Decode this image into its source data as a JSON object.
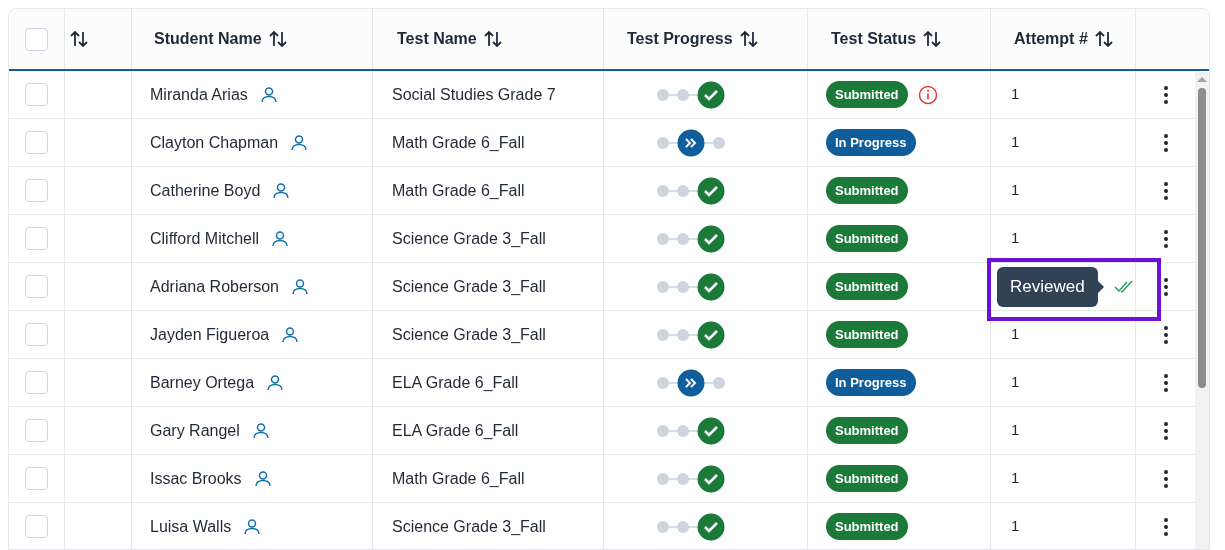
{
  "header": {
    "select_all": {
      "checked": false
    },
    "columns": [
      "Student Name",
      "Test Name",
      "Test Progress",
      "Test Status",
      "Attempt #"
    ]
  },
  "rows": [
    {
      "checked": false,
      "student": "Miranda Arias",
      "test": "Social Studies Grade 7",
      "progress": {
        "kind": "submitted"
      },
      "status": {
        "label": "Submitted",
        "kind": "submitted"
      },
      "alert": true,
      "attempt": "1"
    },
    {
      "checked": false,
      "student": "Clayton Chapman",
      "test": "Math Grade 6_Fall",
      "progress": {
        "kind": "in_progress"
      },
      "status": {
        "label": "In Progress",
        "kind": "in_progress"
      },
      "alert": false,
      "attempt": "1"
    },
    {
      "checked": false,
      "student": "Catherine Boyd",
      "test": "Math Grade 6_Fall",
      "progress": {
        "kind": "submitted"
      },
      "status": {
        "label": "Submitted",
        "kind": "submitted"
      },
      "alert": false,
      "attempt": "1"
    },
    {
      "checked": false,
      "student": "Clifford Mitchell",
      "test": "Science Grade 3_Fall",
      "progress": {
        "kind": "submitted"
      },
      "status": {
        "label": "Submitted",
        "kind": "submitted"
      },
      "alert": false,
      "attempt": "1"
    },
    {
      "checked": false,
      "student": "Adriana Roberson",
      "test": "Science Grade 3_Fall",
      "progress": {
        "kind": "submitted"
      },
      "status": {
        "label": "Submitted",
        "kind": "submitted"
      },
      "alert": false,
      "reviewed": true,
      "tooltip": "Reviewed",
      "highlighted": true
    },
    {
      "checked": false,
      "student": "Jayden Figueroa",
      "test": "Science Grade 3_Fall",
      "progress": {
        "kind": "submitted"
      },
      "status": {
        "label": "Submitted",
        "kind": "submitted"
      },
      "alert": false,
      "attempt": "1"
    },
    {
      "checked": false,
      "student": "Barney Ortega",
      "test": "ELA Grade 6_Fall",
      "progress": {
        "kind": "in_progress"
      },
      "status": {
        "label": "In Progress",
        "kind": "in_progress"
      },
      "alert": false,
      "attempt": "1"
    },
    {
      "checked": false,
      "student": "Gary Rangel",
      "test": "ELA Grade 6_Fall",
      "progress": {
        "kind": "submitted"
      },
      "status": {
        "label": "Submitted",
        "kind": "submitted"
      },
      "alert": false,
      "attempt": "1"
    },
    {
      "checked": false,
      "student": "Issac Brooks",
      "test": "Math Grade 6_Fall",
      "progress": {
        "kind": "submitted"
      },
      "status": {
        "label": "Submitted",
        "kind": "submitted"
      },
      "alert": false,
      "attempt": "1"
    },
    {
      "checked": false,
      "student": "Luisa Walls",
      "test": "Science Grade 3_Fall",
      "progress": {
        "kind": "submitted"
      },
      "status": {
        "label": "Submitted",
        "kind": "submitted"
      },
      "alert": false,
      "attempt": "1"
    }
  ]
}
